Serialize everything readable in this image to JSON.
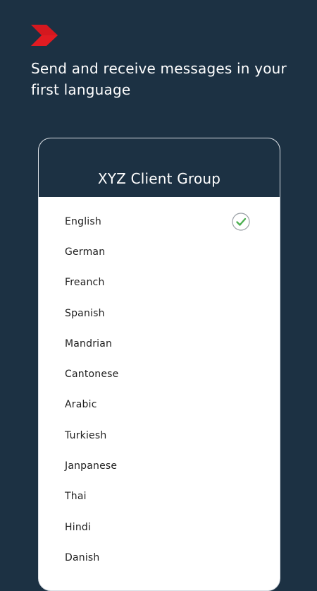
{
  "header": {
    "logo_icon": "red-chevron-logo-icon",
    "headline": "Send and receive messages in your first language"
  },
  "card": {
    "title": "XYZ Client Group",
    "languages": [
      {
        "label": "English",
        "selected": true
      },
      {
        "label": "German",
        "selected": false
      },
      {
        "label": "Freanch",
        "selected": false
      },
      {
        "label": "Spanish",
        "selected": false
      },
      {
        "label": "Mandrian",
        "selected": false
      },
      {
        "label": "Cantonese",
        "selected": false
      },
      {
        "label": "Arabic",
        "selected": false
      },
      {
        "label": "Turkiesh",
        "selected": false
      },
      {
        "label": "Janpanese",
        "selected": false
      },
      {
        "label": "Thai",
        "selected": false
      },
      {
        "label": "Hindi",
        "selected": false
      },
      {
        "label": "Danish",
        "selected": false
      }
    ]
  },
  "colors": {
    "background": "#1c3143",
    "accent_red": "#e11b22",
    "check_green": "#4caf50"
  }
}
